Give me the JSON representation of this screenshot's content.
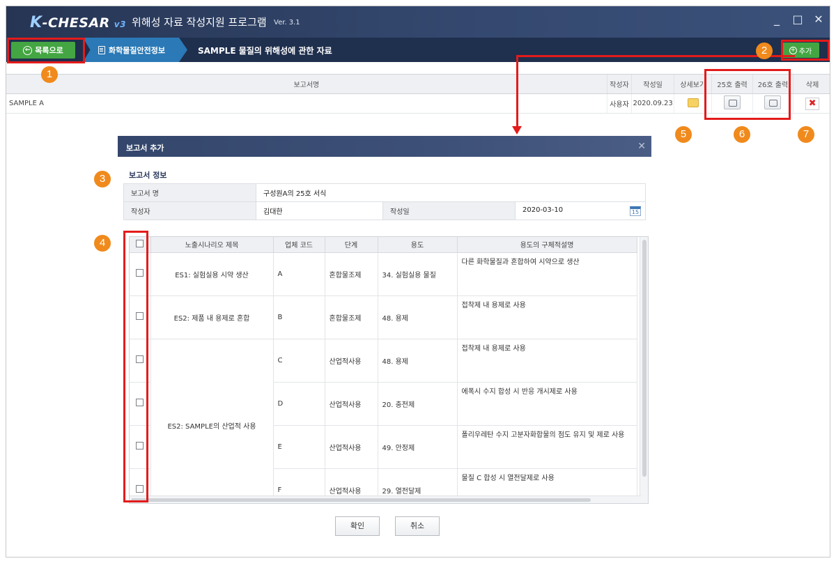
{
  "titlebar": {
    "logo_prefix": "K",
    "logo_main": "-CHESAR",
    "logo_version": "v3",
    "title": "위해성 자료 작성지원 프로그램",
    "version": "Ver. 3.1",
    "minimize": "_",
    "maximize": "□",
    "close": "✕"
  },
  "navbar": {
    "back_label": "목록으로",
    "crumb_section": "화학물질안전정보",
    "crumb_page": "SAMPLE 물질의 위해성에 관한 자료",
    "add_label": "추가"
  },
  "report_table": {
    "headers": [
      "보고서명",
      "작성자",
      "작성일",
      "상세보기",
      "25호 출력",
      "26호 출력",
      "삭제"
    ],
    "rows": [
      {
        "name": "SAMPLE A",
        "author": "사용자",
        "date": "2020.09.23",
        "delete_icon": "✖"
      }
    ]
  },
  "dialog": {
    "title": "보고서 추가",
    "close": "✕",
    "section_title": "보고서 정보",
    "report_name_label": "보고서 명",
    "report_name_value": "구성원A의 25호 서식",
    "author_label": "작성자",
    "author_value": "김대한",
    "date_label": "작성일",
    "date_value": "2020-03-10",
    "calendar_day": "15",
    "grid_headers": [
      "노출시나리오 제목",
      "업체 코드",
      "단계",
      "용도",
      "용도의 구체적설명"
    ],
    "scenarios": [
      {
        "title": "ES1: 실험실용 시약 생산",
        "code": "A",
        "stage": "혼합물조제",
        "use": "34. 실험실용 물질",
        "desc": "다른 화학물질과 혼합하여 시약으로 생산"
      },
      {
        "title": "ES2: 제품 내 용제로 혼합",
        "code": "B",
        "stage": "혼합물조제",
        "use": "48. 용제",
        "desc": "접착제 내 용제로 사용"
      },
      {
        "title": "ES2: SAMPLE의 산업적 사용",
        "code": "C",
        "stage": "산업적사용",
        "use": "48. 용제",
        "desc": "접착제 내 용제로 사용"
      },
      {
        "title": "",
        "code": "D",
        "stage": "산업적사용",
        "use": "20. 충전제",
        "desc": "에폭시 수지 합성 시 반응 개시제로 사용"
      },
      {
        "title": "",
        "code": "E",
        "stage": "산업적사용",
        "use": "49. 안정제",
        "desc": "폴리우레탄 수지 고분자화합물의 점도 유지 및 제로 사용"
      },
      {
        "title": "",
        "code": "F",
        "stage": "산업적사용",
        "use": "29. 열전달제",
        "desc": "물질 C 합성 시 열전달제로 사용"
      }
    ],
    "confirm_label": "확인",
    "cancel_label": "취소"
  },
  "callouts": [
    "1",
    "2",
    "3",
    "4",
    "5",
    "6",
    "7"
  ],
  "colors": {
    "accent_green": "#44a642",
    "nav_dark": "#1f2f4e",
    "crumb_blue": "#2b79b6",
    "highlight_red": "#e31b1b",
    "callout_orange": "#f08a1c"
  },
  "icons": [
    "back-arrow-icon",
    "document-icon",
    "plus-circle-icon",
    "folder-icon",
    "printer-icon",
    "delete-x-icon",
    "calendar-icon",
    "close-icon"
  ]
}
